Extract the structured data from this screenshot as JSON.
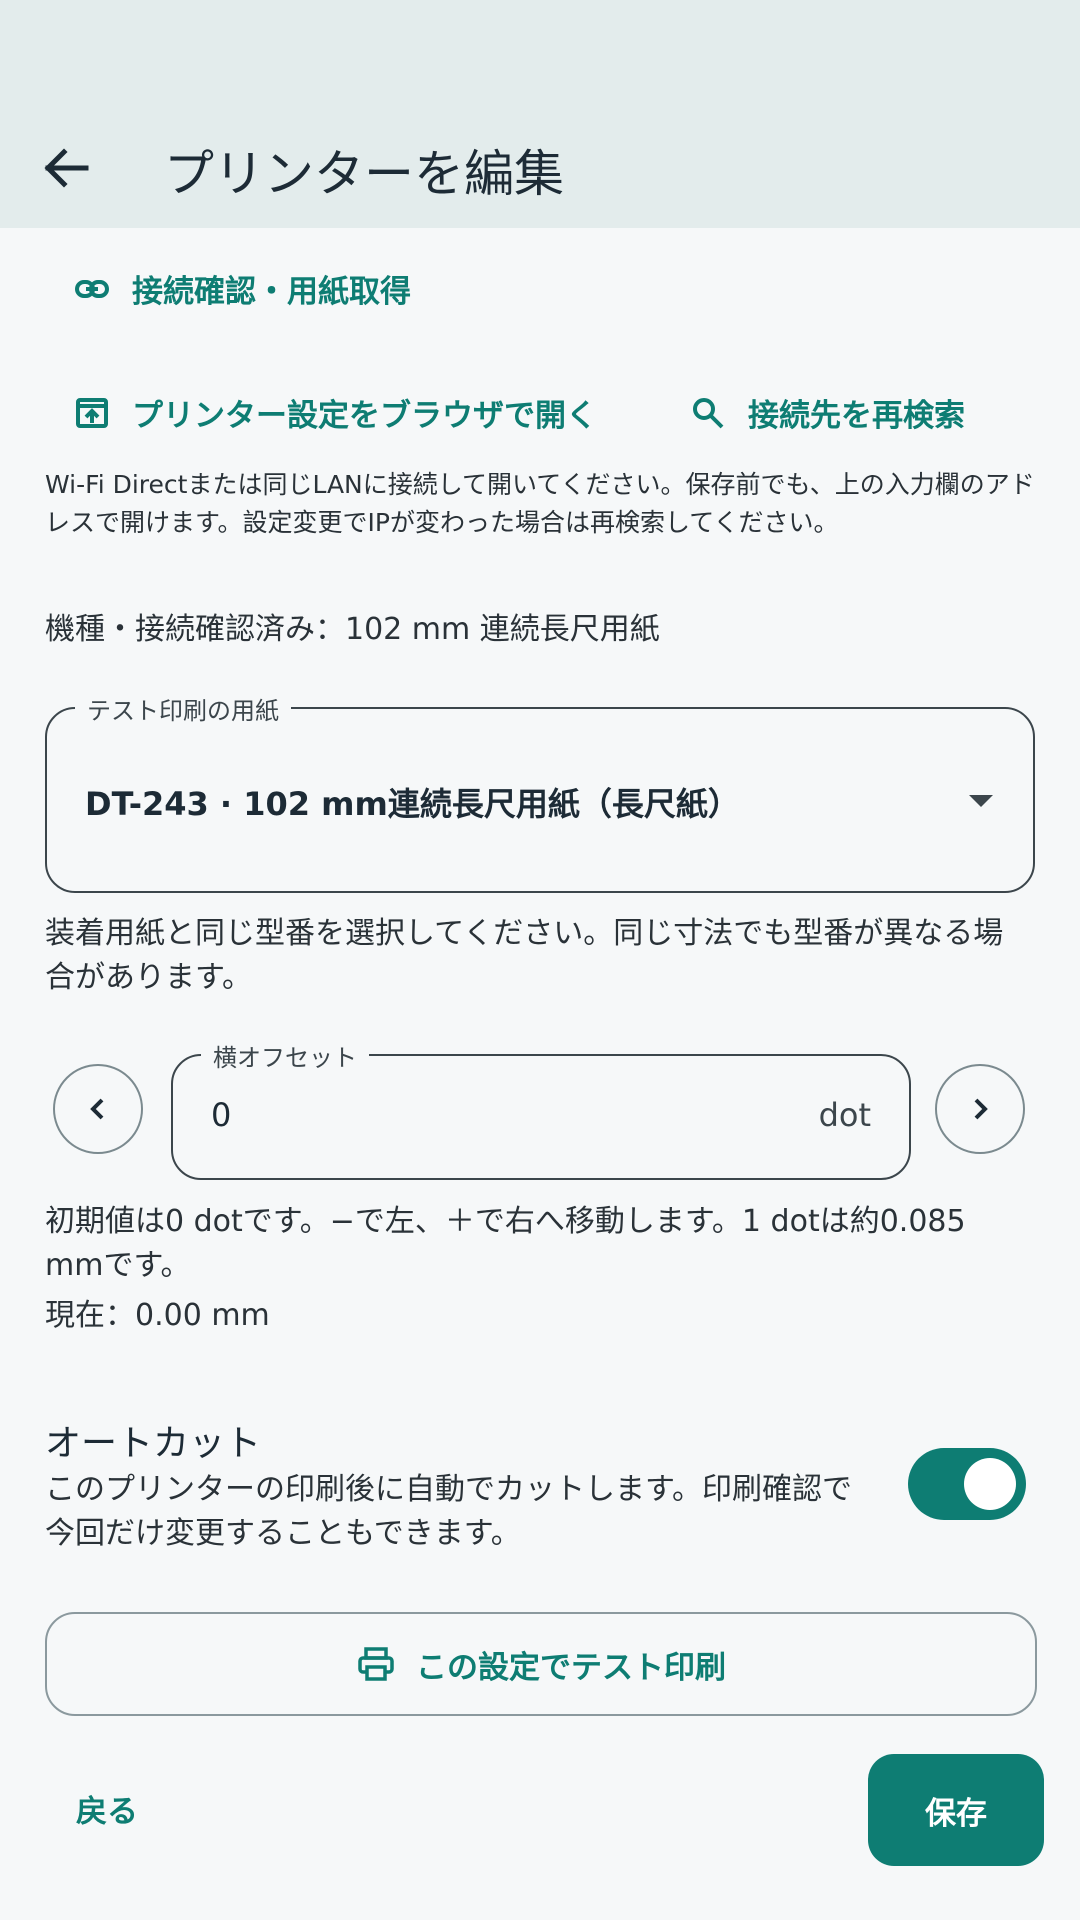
{
  "header": {
    "title": "プリンターを編集"
  },
  "actions": {
    "check_connection": "接続確認・用紙取得",
    "open_settings": "プリンター設定をブラウザで開く",
    "rescan": "接続先を再検索"
  },
  "info": {
    "browser_note": "Wi-Fi Directまたは同じLANに接続して開いてください。保存前でも、上の入力欄のアドレスで開けます。設定変更でIPが変わった場合は再検索してください。",
    "model_status": "機種・接続確認済み：102 mm 連続長尺用紙"
  },
  "paper_select": {
    "label": "テスト印刷の用紙",
    "value": "DT-243 · 102 mm連続長尺用紙（長尺紙）",
    "hint": "装着用紙と同じ型番を選択してください。同じ寸法でも型番が異なる場合があります。"
  },
  "offset": {
    "label": "横オフセット",
    "value": "0",
    "unit": "dot",
    "hint": "初期値は0 dotです。−で左、＋で右へ移動します。1 dotは約0.085 mmです。",
    "current": "現在：0.00 mm"
  },
  "autocut": {
    "title": "オートカット",
    "description": "このプリンターの印刷後に自動でカットします。印刷確認で今回だけ変更することもできます。",
    "enabled": true
  },
  "buttons": {
    "test_print": "この設定でテスト印刷",
    "back": "戻る",
    "save": "保存"
  },
  "colors": {
    "accent": "#0e7d73",
    "appbar": "#e3ecec",
    "background": "#f6f8f9"
  }
}
